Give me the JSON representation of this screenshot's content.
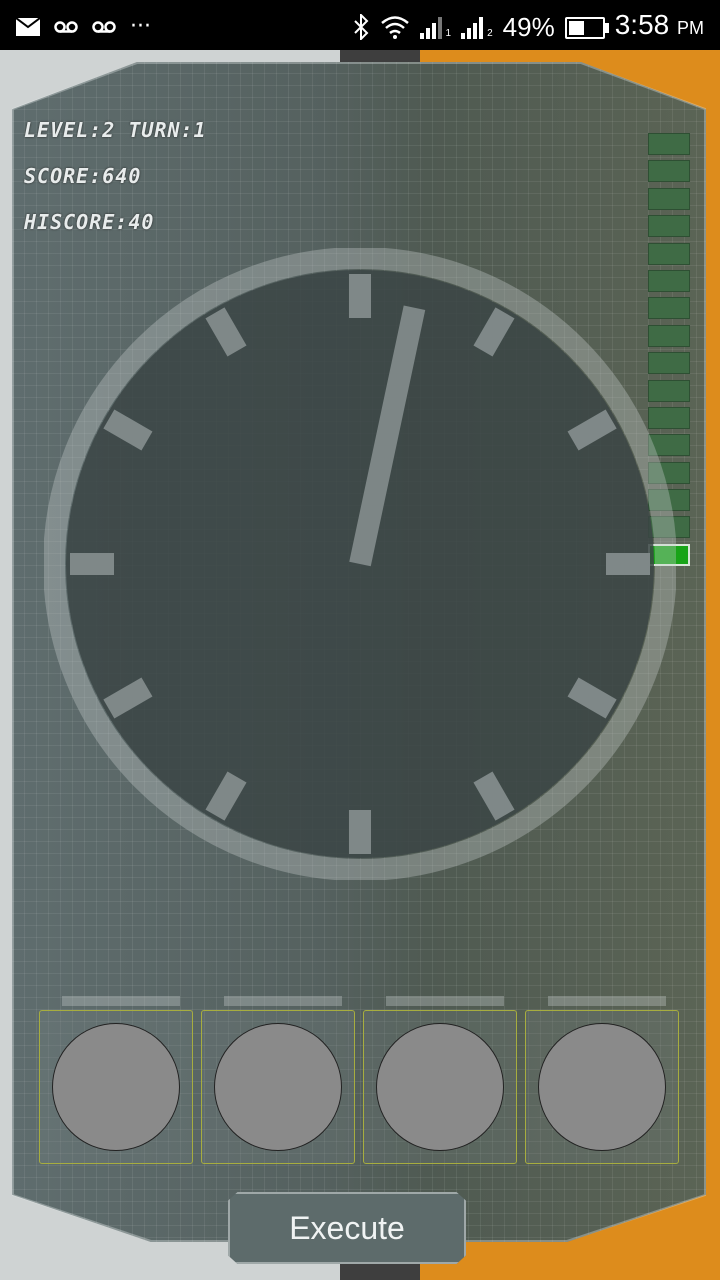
{
  "status_bar": {
    "time": "3:58",
    "ampm": "PM",
    "battery_percent_text": "49%",
    "battery_level": 0.49,
    "sim1_label": "1",
    "sim2_label": "2",
    "overflow": "···",
    "icons": [
      "email-icon",
      "voicemail-icon",
      "voicemail-icon",
      "bluetooth-icon",
      "wifi-icon",
      "signal-icon",
      "signal-icon",
      "battery-icon"
    ]
  },
  "hud": {
    "level_turn": "LEVEL:2   TURN:1",
    "score": "SCORE:640",
    "hiscore": "HISCORE:40"
  },
  "meter": {
    "total_cells": 16,
    "active_index": 15,
    "colors": {
      "off": "#3f6b45",
      "on": "#18a418"
    }
  },
  "clock": {
    "hand_minute_value": 2,
    "ticks": 12
  },
  "slots": [
    {
      "name": "slot-1"
    },
    {
      "name": "slot-2"
    },
    {
      "name": "slot-3"
    },
    {
      "name": "slot-4"
    }
  ],
  "execute_button": {
    "label": "Execute"
  }
}
